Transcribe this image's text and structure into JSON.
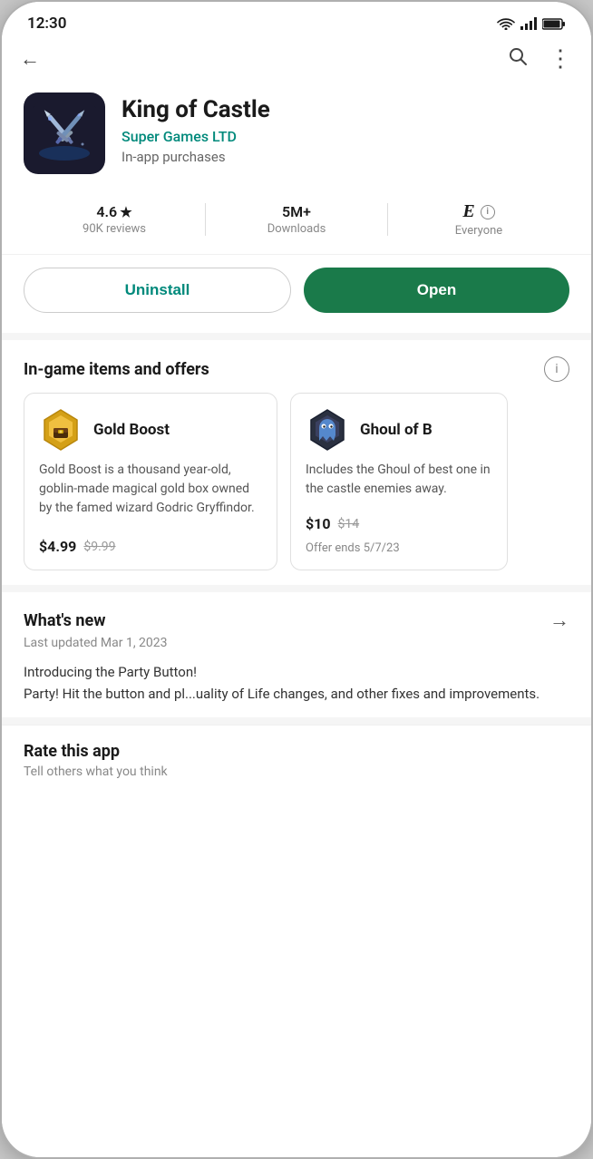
{
  "statusBar": {
    "time": "12:30"
  },
  "nav": {
    "back_label": "←",
    "search_label": "🔍",
    "more_label": "⋮"
  },
  "app": {
    "name": "King of Castle",
    "developer": "Super Games LTD",
    "purchase_info": "In-app purchases",
    "icon_bg": "#1a1a2e"
  },
  "stats": {
    "rating": "4.6",
    "rating_star": "★",
    "reviews": "90K reviews",
    "downloads": "5M+",
    "downloads_label": "Downloads",
    "rating_label": "Everyone",
    "rating_code": "E",
    "info_label": "ℹ"
  },
  "actions": {
    "uninstall": "Uninstall",
    "open": "Open"
  },
  "ingame": {
    "section_title": "In-game items and offers",
    "info_icon": "i",
    "items": [
      {
        "name": "Gold Boost",
        "description": "Gold Boost is a thousand year-old, goblin-made magical gold box owned by the famed wizard Godric Gryffindor.",
        "price": "$4.99",
        "old_price": "$9.99"
      },
      {
        "name": "Ghoul of B",
        "description": "Includes the Ghoul of best one in the castle enemies away.",
        "price": "$10",
        "old_price": "$14",
        "offer_end": "Offer ends 5/7/23"
      }
    ]
  },
  "whatsNew": {
    "title": "What's new",
    "date": "Last updated Mar 1, 2023",
    "arrow": "→",
    "text": "Introducing the Party Button!\nParty! Hit the button and pl...uality of Life changes, and other fixes and improvements."
  },
  "rate": {
    "title": "Rate this app",
    "subtitle": "Tell others what you think"
  }
}
